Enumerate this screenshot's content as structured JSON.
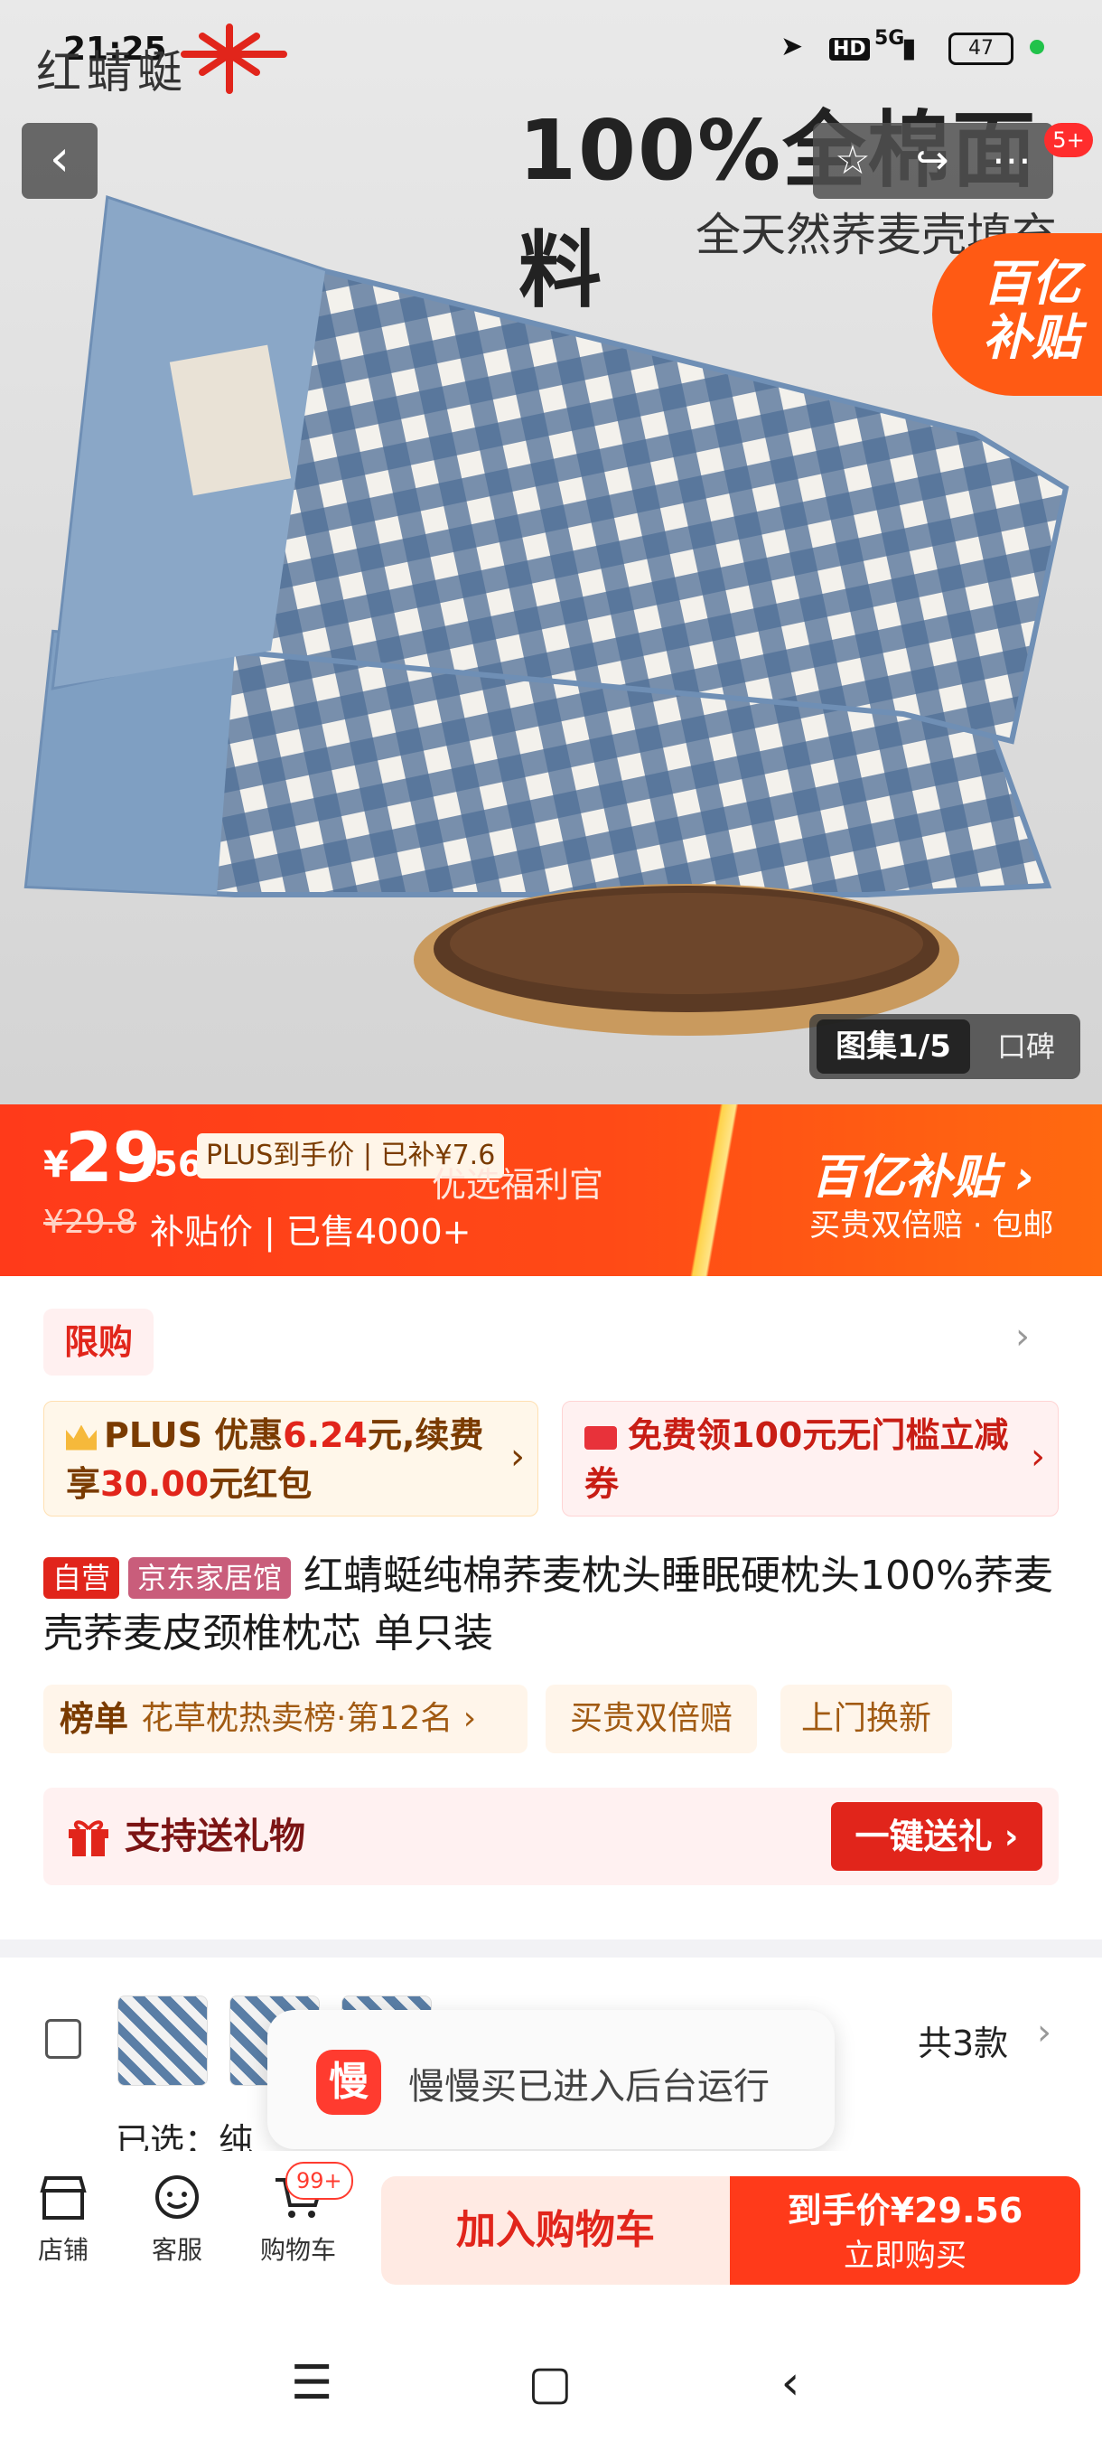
{
  "status_bar": {
    "time": "21:25",
    "hd": "HD",
    "network": "5G",
    "battery": "47"
  },
  "hero": {
    "brand": "红蜻蜓",
    "title": "100%全棉面料",
    "subtitle": "全天然荞麦壳填充",
    "subsidy_badge_line1": "百亿",
    "subsidy_badge_line2": "补贴",
    "notification_badge": "5+",
    "gallery_counter": "图集1/5",
    "gallery_reviews": "口碑"
  },
  "price_banner": {
    "currency": "¥",
    "price_int": "29",
    "price_dec": ".56",
    "plus_tag": "PLUS到手价 | 已补¥7.6",
    "official": "优选福利官",
    "orig_price": "¥29.8",
    "sold_info": "补贴价 | 已售4000+",
    "subsidy_logo": "百亿补贴 ›",
    "subsidy_desc": "买贵双倍赔 · 包邮"
  },
  "card": {
    "limit_tag": "限购",
    "coupon1": {
      "prefix": "PLUS 优惠",
      "amount": "6.24",
      "mid": "元,续费享",
      "amount2": "30.00",
      "suffix": "元红包"
    },
    "coupon2": {
      "text": "免费领100元无门槛立减券"
    },
    "self_tag": "自营",
    "store_tag": "京东家居馆",
    "product_title": "红蜻蜓纯棉荞麦枕头睡眠硬枕头100%荞麦壳荞麦皮颈椎枕芯 单只装",
    "rank_label": "榜单",
    "rank_text": "花草枕热卖榜·第12名 ›",
    "pill1": "买贵双倍赔",
    "pill2": "上门换新",
    "gift_label": "支持送礼物",
    "gift_button": "一键送礼 ›"
  },
  "spec": {
    "count": "共3款",
    "selected": "已选：纯"
  },
  "toast": {
    "icon_text": "慢",
    "text": "慢慢买已进入后台运行"
  },
  "bottom_bar": {
    "shop": "店铺",
    "service": "客服",
    "cart": "购物车",
    "cart_badge": "99+",
    "add_cart": "加入购物车",
    "buy_price_label": "到手价¥29.56",
    "buy_now": "立即购买"
  },
  "colors": {
    "accent": "#ff3a1a",
    "red": "#e1251b",
    "brown": "#7a3b00"
  }
}
